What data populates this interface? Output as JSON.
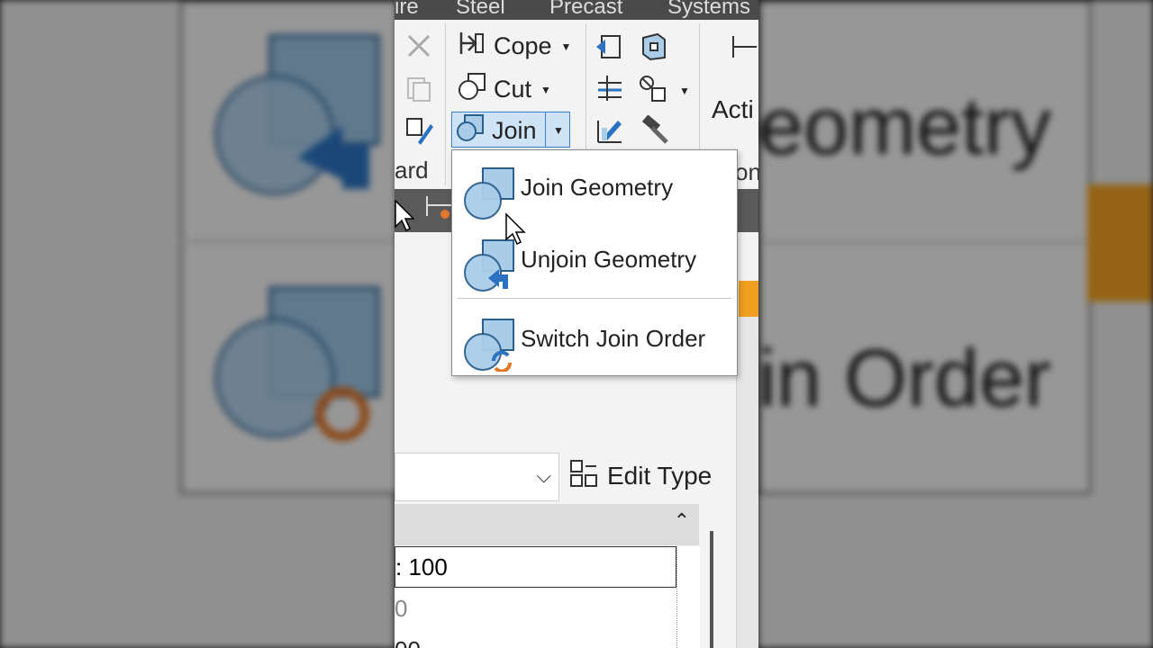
{
  "background": {
    "left_label_1": "",
    "right_label_1": "eometry",
    "right_label_2": "in Order"
  },
  "ribbon": {
    "tabs": [
      "ire",
      "Steel",
      "Precast",
      "Systems"
    ],
    "buttons": {
      "cope": "Cope",
      "cut": "Cut",
      "join": "Join",
      "activate_partial": "Acti"
    },
    "panel_label_left": "ard",
    "panel_label_right": "on"
  },
  "dropdown": {
    "items": [
      {
        "label": "Join Geometry",
        "icon": "join-geometry-icon"
      },
      {
        "label": "Unjoin Geometry",
        "icon": "unjoin-geometry-icon"
      },
      {
        "label": "Switch Join Order",
        "icon": "switch-join-order-icon"
      }
    ]
  },
  "properties": {
    "type_selector_value": "",
    "edit_type": "Edit Type",
    "rows": [
      ": 100",
      "0",
      "00"
    ]
  },
  "colors": {
    "accent_blue": "#3c7fc4",
    "icon_blue": "#a9cde9",
    "icon_orange": "#e0772b"
  }
}
